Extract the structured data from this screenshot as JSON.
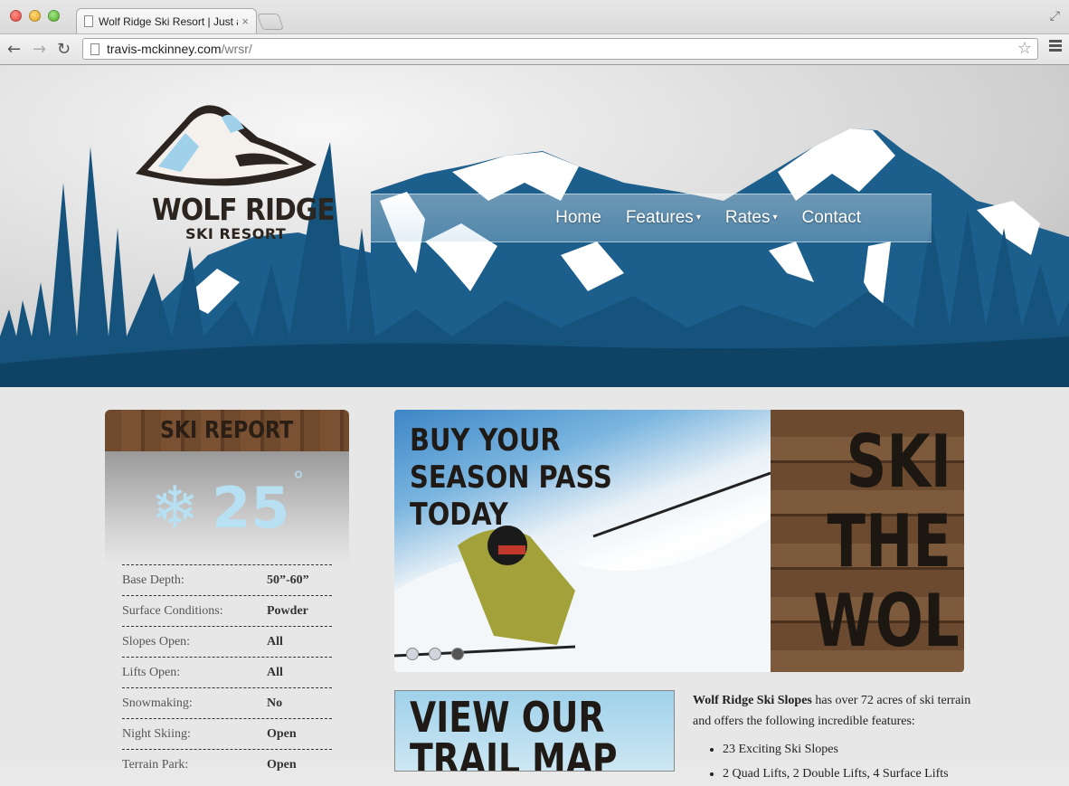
{
  "browser": {
    "tab_title": "Wolf Ridge Ski Resort | Just a",
    "tab_close": "×",
    "url_host": "travis-mckinney.com",
    "url_path": "/wrsr/"
  },
  "logo": {
    "title": "WOLF RIDGE",
    "subtitle": "SKI RESORT"
  },
  "nav": {
    "items": [
      {
        "label": "Home",
        "has_dropdown": false
      },
      {
        "label": "Features",
        "has_dropdown": true
      },
      {
        "label": "Rates",
        "has_dropdown": true
      },
      {
        "label": "Contact",
        "has_dropdown": false
      }
    ],
    "caret": "▾"
  },
  "ski_report": {
    "heading": "SKI REPORT",
    "temperature": "25",
    "degree": "°",
    "rows": [
      {
        "label": "Base Depth:",
        "value": "50”-60”"
      },
      {
        "label": "Surface Conditions:",
        "value": "Powder"
      },
      {
        "label": "Slopes Open:",
        "value": "All"
      },
      {
        "label": "Lifts Open:",
        "value": "All"
      },
      {
        "label": "Snowmaking:",
        "value": "No"
      },
      {
        "label": "Night Skiing:",
        "value": "Open"
      },
      {
        "label": "Terrain Park:",
        "value": "Open"
      }
    ]
  },
  "slider": {
    "headline": [
      "BUY YOUR",
      "SEASON PASS",
      "TODAY"
    ],
    "tagline": [
      "SKI",
      "THE",
      "WOLF"
    ],
    "active_dot": 3,
    "dot_count": 3
  },
  "trail_map": {
    "title": "VIEW OUR TRAIL MAP"
  },
  "description": {
    "lead_bold": "Wolf Ridge Ski Slopes",
    "lead_rest": " has over 72 acres of ski terrain and offers the following incredible features:",
    "features": [
      "23 Exciting Ski Slopes",
      "2 Quad Lifts, 2 Double Lifts, 4 Surface Lifts"
    ]
  },
  "colors": {
    "mountain_blue": "#1d5f8c",
    "dark_blue": "#0f4366",
    "snow": "#ffffff",
    "wood": "#6b4a30",
    "temp_text": "#b7e1f3"
  }
}
